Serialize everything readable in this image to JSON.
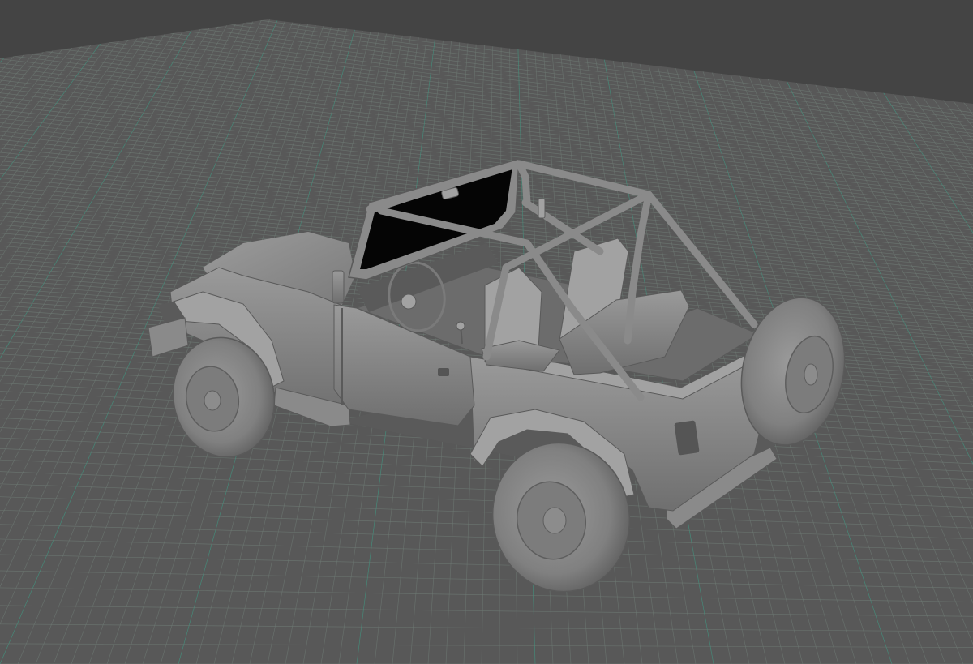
{
  "viewport": {
    "background_color": "#444444",
    "ground_color": "#585858",
    "grid_color": "#6e7a74",
    "grid_axis_color": "#3e9e86",
    "object_color": "#8a8a8a",
    "object_shadow_color": "#5a5a5a",
    "object_highlight_color": "#a2a2a2",
    "windshield_glass_color": "#050505"
  },
  "scene": {
    "objects": [
      {
        "kind": "jeep-model",
        "icon": "car-icon"
      }
    ]
  }
}
